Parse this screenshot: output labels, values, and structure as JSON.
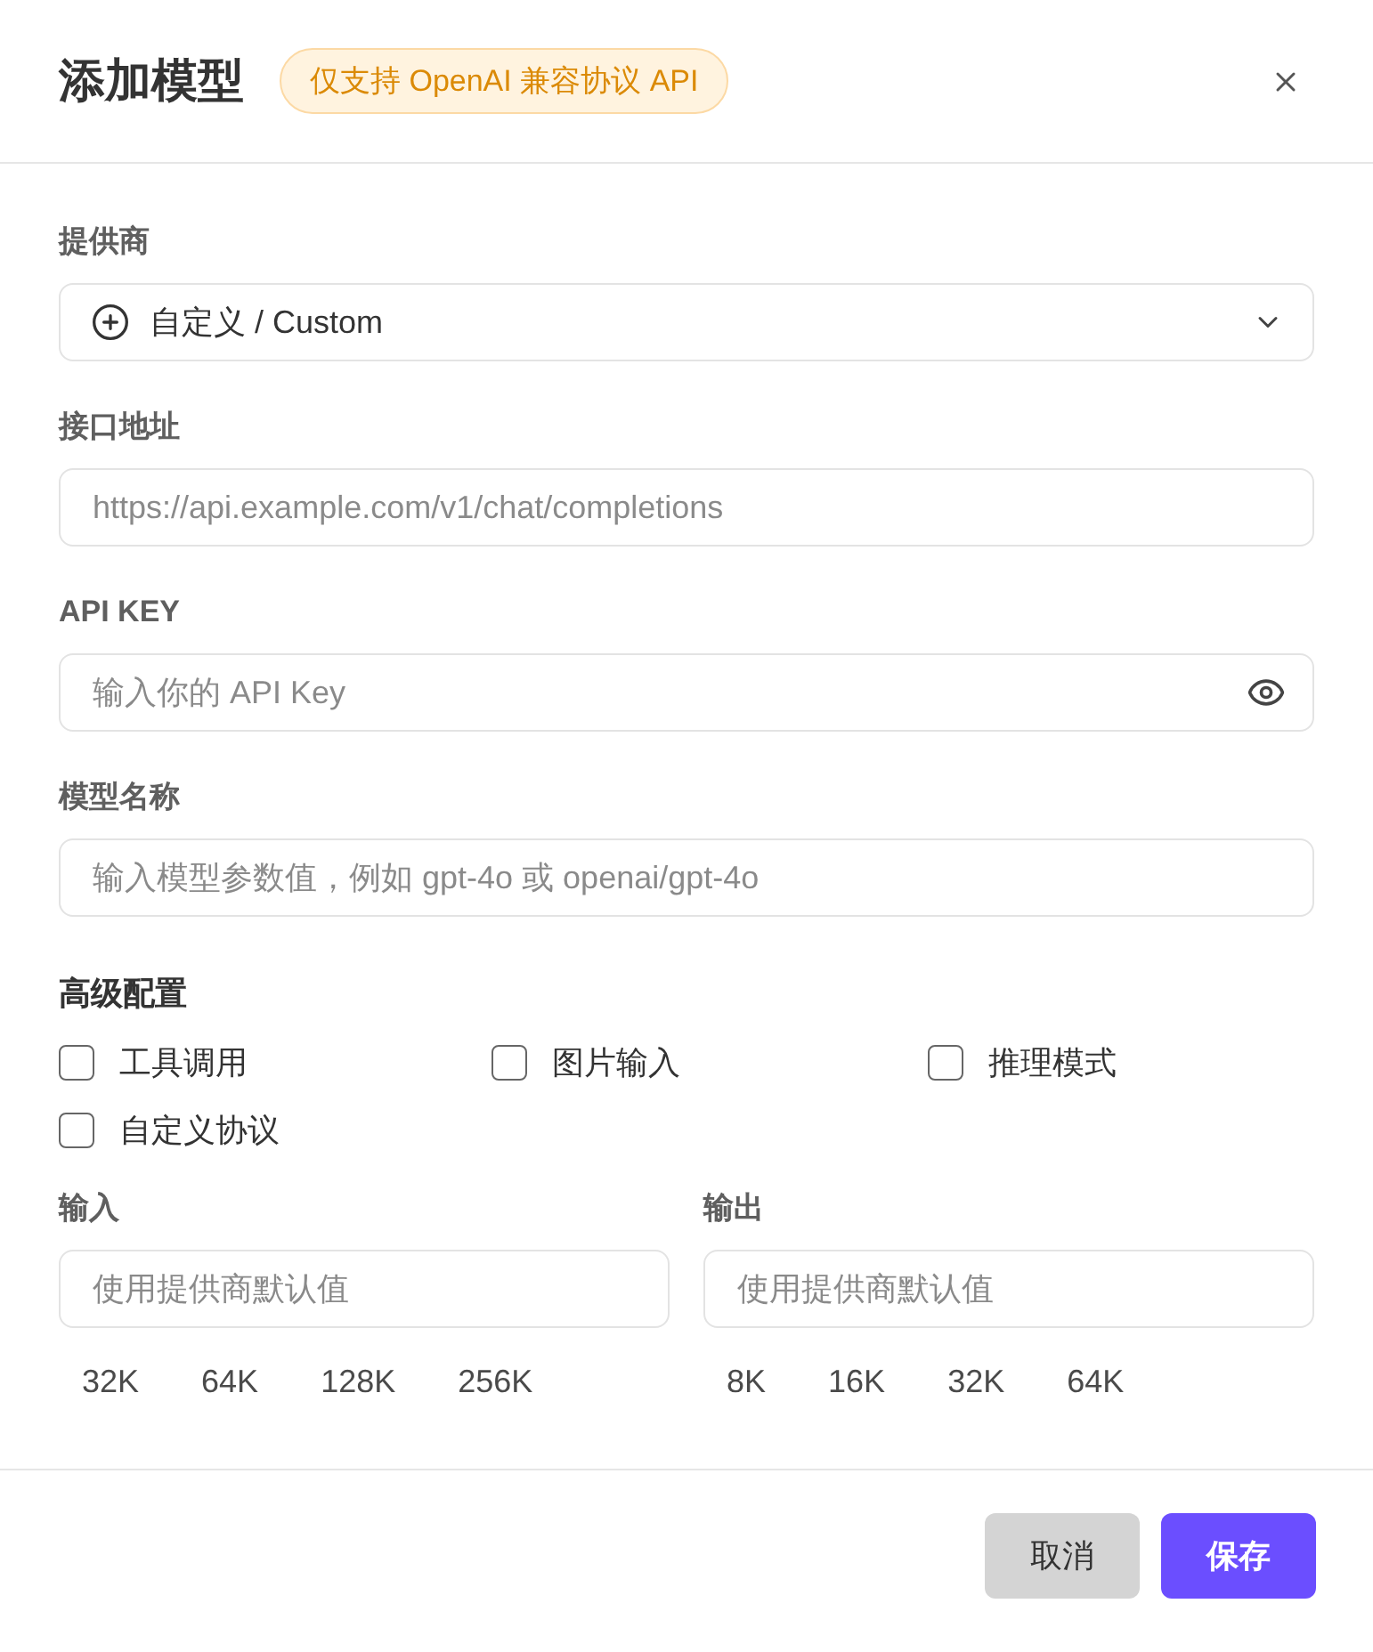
{
  "dialog": {
    "title": "添加模型",
    "badge": "仅支持 OpenAI 兼容协议 API"
  },
  "fields": [
    {
      "kind": "select",
      "label": "提供商",
      "value": "自定义 / Custom"
    },
    {
      "kind": "text",
      "label": "接口地址",
      "placeholder": "https://api.example.com/v1/chat/completions"
    },
    {
      "kind": "secret",
      "label": "API KEY",
      "placeholder": "输入你的 API Key"
    },
    {
      "kind": "text",
      "label": "模型名称",
      "placeholder": "输入模型参数值，例如 gpt-4o 或 openai/gpt-4o"
    }
  ],
  "advanced": {
    "title": "高级配置",
    "options": [
      {
        "label": "工具调用",
        "checked": false
      },
      {
        "label": "图片输入",
        "checked": false
      },
      {
        "label": "推理模式",
        "checked": false
      },
      {
        "label": "自定义协议",
        "checked": false
      }
    ]
  },
  "context_windows": [
    {
      "label": "输入",
      "placeholder": "使用提供商默认值",
      "presets": [
        "32K",
        "64K",
        "128K",
        "256K"
      ]
    },
    {
      "label": "输出",
      "placeholder": "使用提供商默认值",
      "presets": [
        "8K",
        "16K",
        "32K",
        "64K"
      ]
    }
  ],
  "buttons": [
    {
      "kind": "secondary",
      "label": "取消"
    },
    {
      "kind": "primary",
      "label": "保存"
    }
  ]
}
